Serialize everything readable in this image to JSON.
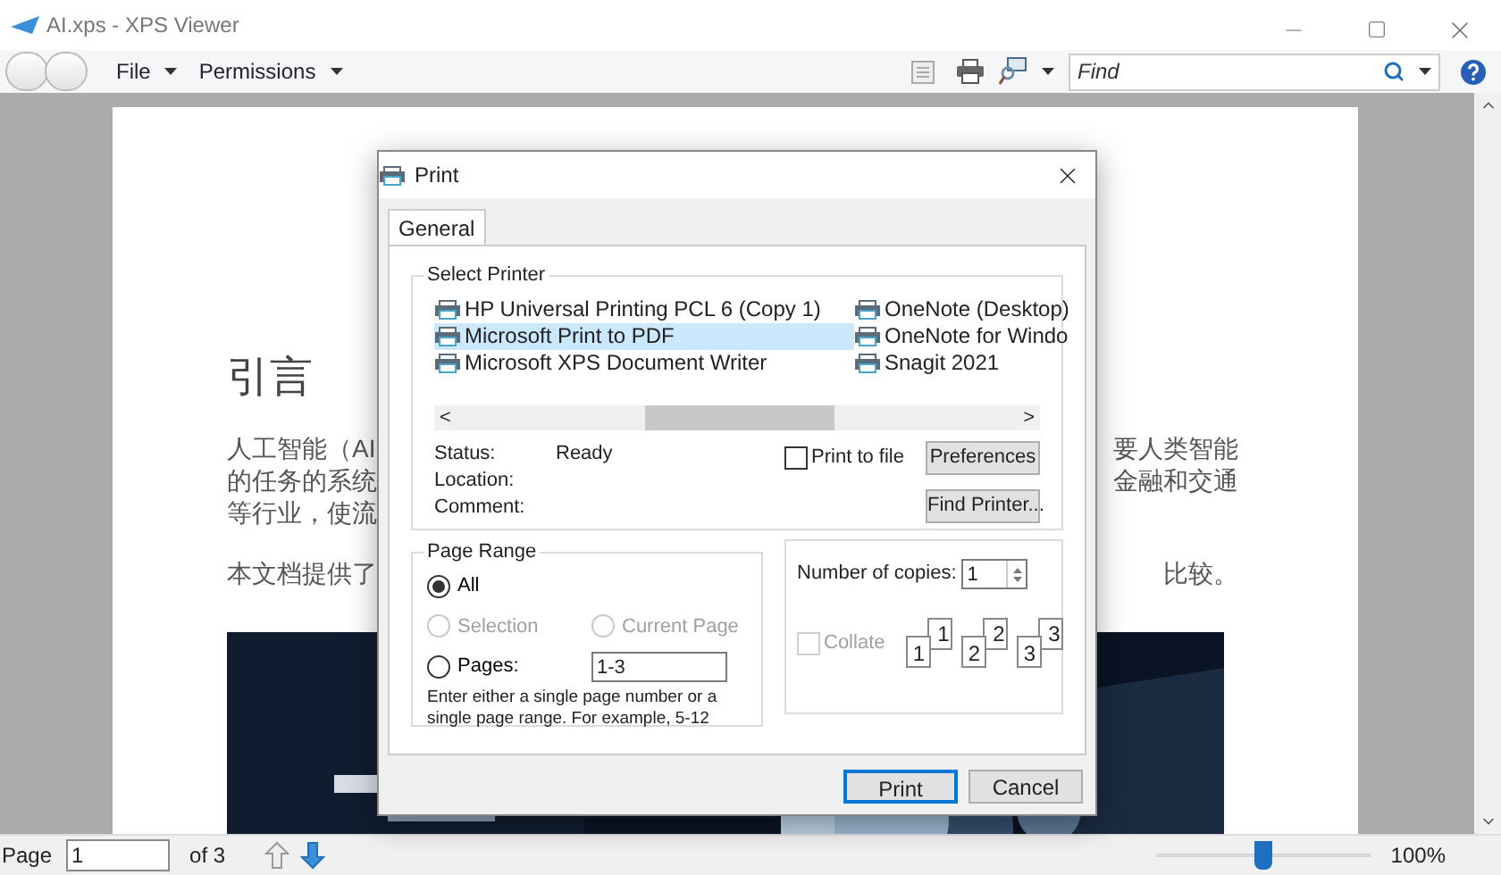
{
  "window": {
    "title": "AI.xps - XPS Viewer"
  },
  "menu": [
    "File",
    "Permissions"
  ],
  "find": {
    "placeholder": "Find"
  },
  "document": {
    "heading": "引言",
    "paragraphs": [
      [
        {
          "left": "人工智能（AI",
          "right": "要人类智能"
        },
        {
          "left": "的任务的系统",
          "right": "金融和交通"
        },
        {
          "left": "等行业，使流"
        }
      ],
      [
        {
          "left": "本文档提供了",
          "right": "比较。"
        }
      ]
    ]
  },
  "dialog": {
    "title": "Print",
    "tabs": [
      {
        "label": "General",
        "selected": true
      }
    ],
    "printer_group": "Select Printer",
    "printers": [
      {
        "name": "HP Universal Printing PCL 6 (Copy 1)",
        "selected": false
      },
      {
        "name": "Microsoft Print to PDF",
        "selected": true
      },
      {
        "name": "Microsoft XPS Document Writer",
        "selected": false
      },
      {
        "name": "OneNote (Desktop)",
        "selected": false
      },
      {
        "name": "OneNote for Windo",
        "selected": false
      },
      {
        "name": "Snagit 2021",
        "selected": false
      }
    ],
    "scroll_left": "<",
    "scroll_right": ">",
    "info": [
      {
        "label": "Status:",
        "value": "Ready"
      },
      {
        "label": "Location:"
      },
      {
        "label": "Comment:"
      }
    ],
    "print_to_file": {
      "label": "Print to file",
      "checked": false
    },
    "preferences_button": "Preferences",
    "find_printer_button": "Find Printer...",
    "range_group": "Page Range",
    "ranges": [
      {
        "label": "All",
        "selected": true,
        "disabled": false
      },
      {
        "label": "Selection",
        "selected": false,
        "disabled": true
      },
      {
        "label": "Current Page",
        "selected": false,
        "disabled": true
      },
      {
        "label": "Pages:",
        "selected": false,
        "disabled": false
      }
    ],
    "pages_value": "1-3",
    "range_hint": "Enter either a single page number or a single page range.  For example, 5-12",
    "copies_label": "Number of copies:",
    "copies_value": "1",
    "collate": {
      "label": "Collate",
      "checked": false,
      "disabled": true
    },
    "collate_pages": [
      {
        "front": "1",
        "back": "1"
      },
      {
        "front": "2",
        "back": "2"
      },
      {
        "front": "3",
        "back": "3"
      }
    ],
    "buttons": [
      "Print",
      "Cancel"
    ]
  },
  "status_bar": {
    "page_label": "Page",
    "page_value": "1",
    "page_total": "of 3",
    "zoom": {
      "level": 0.5
    },
    "zoom_text": "100%"
  }
}
